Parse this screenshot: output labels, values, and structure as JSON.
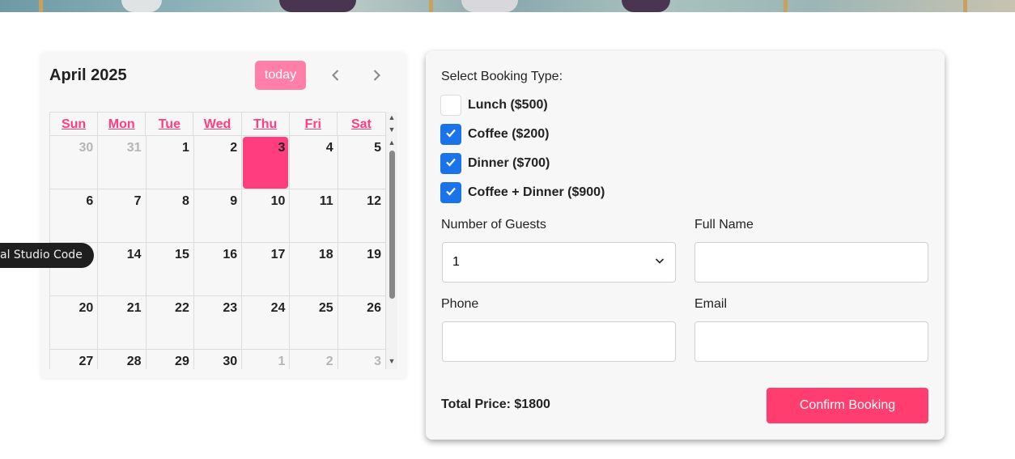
{
  "calendar": {
    "title": "April 2025",
    "today_label": "today",
    "weekdays": [
      "Sun",
      "Mon",
      "Tue",
      "Wed",
      "Thu",
      "Fri",
      "Sat"
    ],
    "weeks": [
      [
        "30",
        "31",
        "1",
        "2",
        "3",
        "4",
        "5"
      ],
      [
        "6",
        "7",
        "8",
        "9",
        "10",
        "11",
        "12"
      ],
      [
        "13",
        "14",
        "15",
        "16",
        "17",
        "18",
        "19"
      ],
      [
        "20",
        "21",
        "22",
        "23",
        "24",
        "25",
        "26"
      ],
      [
        "27",
        "28",
        "29",
        "30",
        "1",
        "2",
        "3"
      ]
    ],
    "today_date": "3"
  },
  "tooltip": {
    "text": "al Studio Code"
  },
  "booking": {
    "type_label": "Select Booking Type:",
    "options": [
      {
        "label": "Lunch ($500)",
        "checked": false
      },
      {
        "label": "Coffee ($200)",
        "checked": true
      },
      {
        "label": "Dinner ($700)",
        "checked": true
      },
      {
        "label": "Coffee + Dinner ($900)",
        "checked": true
      }
    ],
    "guests_label": "Number of Guests",
    "guests_value": "1",
    "fullname_label": "Full Name",
    "fullname_value": "",
    "phone_label": "Phone",
    "phone_value": "",
    "email_label": "Email",
    "email_value": "",
    "total_label": "Total Price: $1800",
    "confirm_label": "Confirm Booking"
  },
  "colors": {
    "accent_pink": "#ff3d7f",
    "today_button": "#ff7fa8",
    "checkbox_blue": "#1a73e8"
  }
}
